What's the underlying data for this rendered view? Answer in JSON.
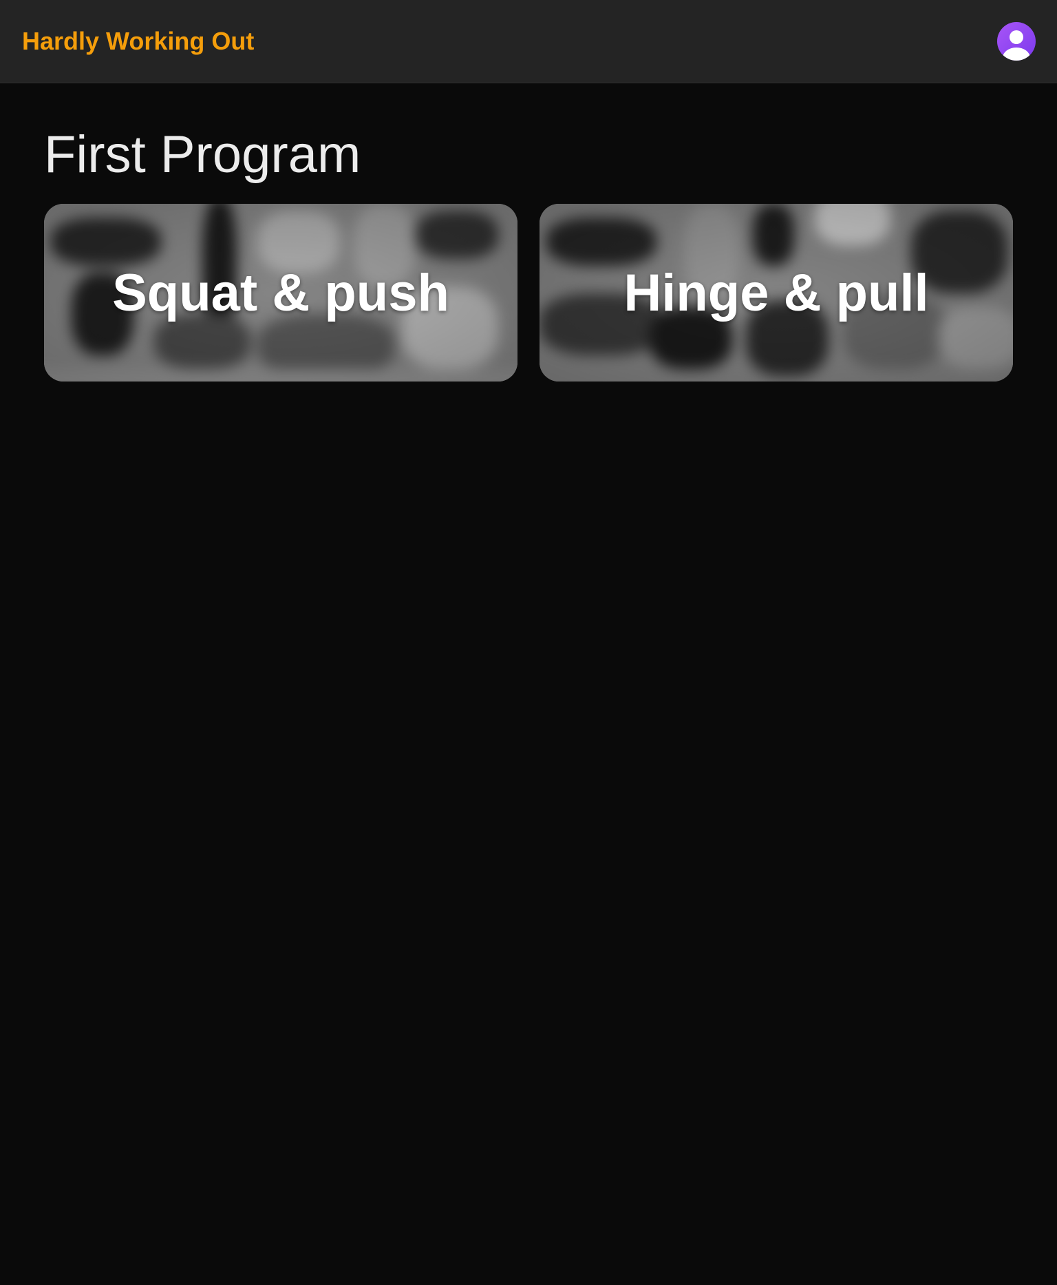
{
  "header": {
    "brand": "Hardly Working Out",
    "brand_color": "#f59e0b",
    "avatar_icon": "user-avatar-icon",
    "avatar_color": "#8b5cf6"
  },
  "program": {
    "title": "First Program",
    "workouts": [
      {
        "label": "Squat & push"
      },
      {
        "label": "Hinge & pull"
      }
    ]
  }
}
